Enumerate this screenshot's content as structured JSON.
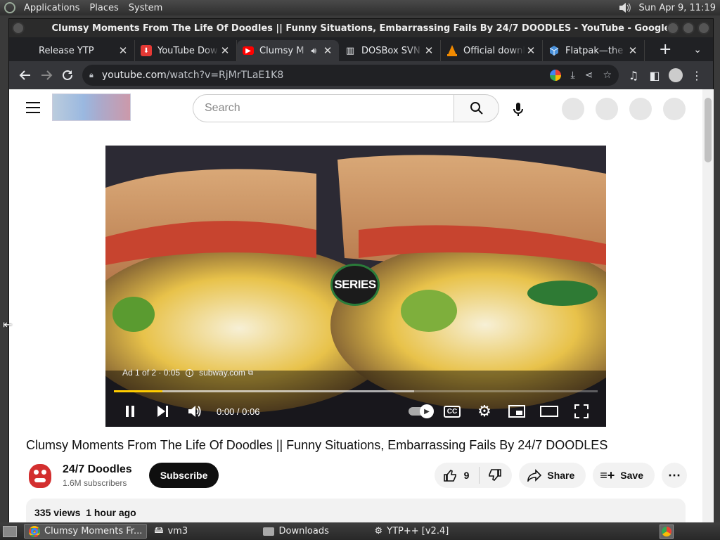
{
  "system": {
    "menus": [
      "Applications",
      "Places",
      "System"
    ],
    "clock": "Sun Apr  9, 11:19"
  },
  "window": {
    "title": "Clumsy Moments From The Life Of Doodles || Funny Situations, Embarrassing Fails By 24/7 DOODLES - YouTube - Google Chrome"
  },
  "tabs": [
    {
      "label": "Release YTP",
      "favicon": "github-icon"
    },
    {
      "label": "YouTube Dow",
      "favicon": "download-red-icon"
    },
    {
      "label": "Clumsy M",
      "favicon": "youtube-icon",
      "audio": true,
      "active": true
    },
    {
      "label": "DOSBox SVN",
      "favicon": "building-icon"
    },
    {
      "label": "Official downl",
      "favicon": "vlc-icon"
    },
    {
      "label": "Flatpak—the",
      "favicon": "flatpak-icon"
    }
  ],
  "address": {
    "domain": "youtube.com",
    "path": "/watch?v=RjMrTLaE1K8"
  },
  "youtube": {
    "search_placeholder": "Search",
    "ad_text": "Ad 1 of 2 · 0:05",
    "ad_domain": "subway.com",
    "logo_text": "SERIES",
    "time": "0:00 / 0:06",
    "progress": 0.1,
    "buffered": 0.62,
    "video_title": "Clumsy Moments From The Life Of Doodles || Funny Situations, Embarrassing Fails By 24/7 DOODLES",
    "channel_name": "24/7 Doodles",
    "subscribers": "1.6M subscribers",
    "subscribe_label": "Subscribe",
    "likes": "9",
    "share_label": "Share",
    "save_label": "Save",
    "stats": "335 views  1 hour ago"
  },
  "taskbar": [
    {
      "label": "Clumsy Moments Fr...",
      "icon": "chrome-icon",
      "active": true
    },
    {
      "label": "vm3",
      "icon": "drive-icon"
    },
    {
      "label": "Downloads",
      "icon": "folder-icon"
    },
    {
      "label": "YTP++ [v2.4]",
      "icon": "ytp-icon"
    }
  ],
  "colors": {
    "youtube_red": "#ff0000",
    "ad_progress": "#ffcc00",
    "chrome_dark": "#35363a"
  }
}
